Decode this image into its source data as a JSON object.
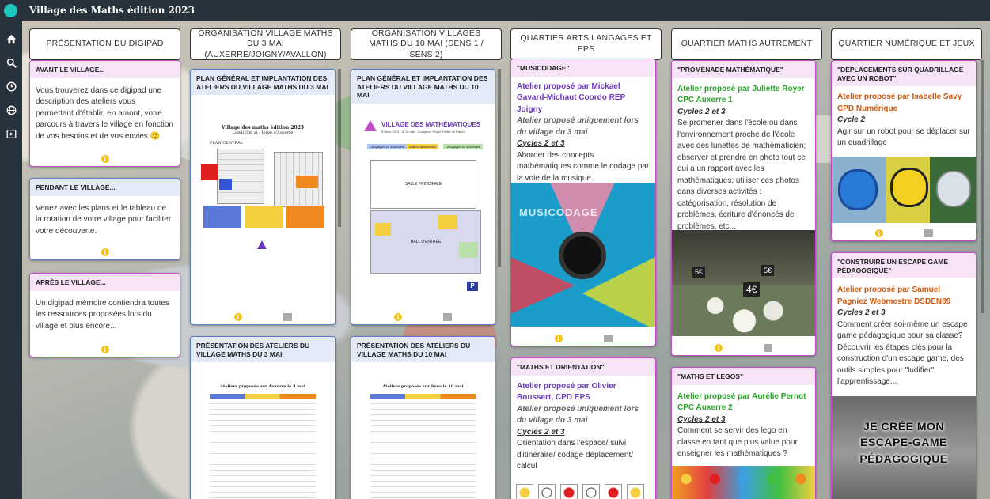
{
  "app": {
    "title": "Village des Maths édition 2023"
  },
  "sidebar": {
    "icons": [
      "home-icon",
      "search-icon",
      "history-icon",
      "globe-icon",
      "presentation-icon"
    ]
  },
  "columns": [
    {
      "title": "PRÉSENTATION DU DIGIPAD"
    },
    {
      "title": "ORGANISATION VILLAGE MATHS DU 3 MAI (AUXERRE/JOIGNY/AVALLON)"
    },
    {
      "title": "ORGANISATION VILLAGES MATHS DU 10 MAI (SENS 1 / SENS 2)"
    },
    {
      "title": "QUARTIER ARTS LANGAGES ET EPS"
    },
    {
      "title": "QUARTIER MATHS AUTREMENT"
    },
    {
      "title": "QUARTIER NUMÉRIQUE ET JEUX"
    }
  ],
  "cards": {
    "avant": {
      "title": "AVANT LE VILLAGE...",
      "text": "Vous trouverez dans ce digipad une description des ateliers vous permettant d'établir, en amont, votre parcours à travers le village en fonction de vos besoins et de vos envies",
      "emoji": "🙂"
    },
    "pendant": {
      "title": "PENDANT LE VILLAGE...",
      "text": "Venez avec les plans et le tableau de la rotation de votre village pour faciliter votre découverte."
    },
    "apres": {
      "title": "APRÈS LE VILLAGE...",
      "text": "Un digipad mémoire contiendra toutes les ressources proposées lors du village et plus encore..."
    },
    "plan3": {
      "title": "PLAN GÉNÉRAL ET IMPLANTATION DES ATELIERS DU VILLAGE MATHS DU 3 MAI",
      "doc_title": "Village des maths édition 2023",
      "doc_sub": "Lundi 3 m ai - Jorge d'Auxerre",
      "doc_label": "PLAN CENTRAL"
    },
    "plan10": {
      "title": "PLAN GÉNÉRAL ET IMPLANTATION DES ATELIERS DU VILLAGE MATHS DU 10 MAI",
      "doc_title": "VILLAGE DES MATHÉMATIQUES",
      "doc_sub": "Édition 2023 - le 10 mai - Complexe Roger Treillé de Paron",
      "legend": [
        "Langages et sciences",
        "Maths autrement",
        "Langages et sciences"
      ],
      "room": "SALLE PRINCIPALE",
      "hall": "HALL D'ENTRÉE"
    },
    "pres3": {
      "title": "PRÉSENTATION DES ATELIERS DU VILLAGE MATHS DU 3 MAI",
      "doc_head": "Ateliers proposés sur Auxerre le 3 mai"
    },
    "pres10": {
      "title": "PRÉSENTATION DES ATELIERS DU VILLAGE MATHS DU 10 MAI",
      "doc_head": "Ateliers proposés sur Sens le 10 mai"
    },
    "musicodage": {
      "title": "\"MUSICODAGE\"",
      "author": "Atelier proposé par Mickael Gavard-Michaut Coordo REP Joigny",
      "note": "Atelier proposé uniquement lors du village du 3 mai",
      "cycle": "Cycles 2 et 3",
      "text": "Aborder des concepts mathématiques comme le codage par la voie de la musique.",
      "image_text": "MUSICODAGE"
    },
    "orientation": {
      "title": "\"MATHS ET ORIENTATION\"",
      "author": "Atelier proposé par Olivier Boussert, CPD EPS",
      "note": "Atelier proposé uniquement lors du village du 3 mai",
      "cycle": "Cycles 2 et 3",
      "text": "Orientation dans l'espace/ suivi d'itinéraire/ codage déplacement/ calcul"
    },
    "promenade": {
      "title": "\"PROMENADE MATHÉMATIQUE\"",
      "author": "Atelier proposé par Juliette Royer CPC Auxerre 1",
      "cycle": "Cycles 2 et 3",
      "text": "Se promener dans l'école ou dans l'environnement proche de l'école avec des lunettes de mathématicien; observer et prendre en photo tout ce qui a un rapport avec les mathématiques; utiliser ces photos dans diverses activités : catégorisation, résolution de problèmes, écriture d'énoncés de problèmes, etc...",
      "price_tags": [
        "5€",
        "5€",
        "4€"
      ]
    },
    "legos": {
      "title": "\"MATHS ET LEGOS\"",
      "author": "Atelier proposé par Aurélie Pernot CPC Auxerre 2",
      "cycle": "Cycles 2 et 3",
      "text": "Comment se servir des lego en classe en tant que plus value pour enseigner les mathématiques ?"
    },
    "robot": {
      "title": "\"DÉPLACEMENTS SUR QUADRILLAGE AVEC UN ROBOT\"",
      "author": "Atelier proposé par Isabelle Savy CPD Numérique",
      "cycle": "Cycle 2",
      "text": "Agir sur un robot pour se déplacer sur un quadrillage"
    },
    "escape": {
      "title": "\"CONSTRUIRE UN ESCAPE GAME PÉDAGOGIQUE\"",
      "author": "Atelier proposé par Samuel Pagniez Webmestre DSDEN89",
      "cycle": "Cycles 2 et 3",
      "text": "Comment créer soi-même un escape game pédagogique pour sa classe? Découvrir les étapes clés pour la construction d'un escape game, des outils simples pour \"ludifier\" l'apprentissage...",
      "image_lines": [
        "JE CRÉE MON",
        "ESCAPE-GAME",
        "PÉDAGOGIQUE"
      ]
    }
  },
  "colors": {
    "topbar": "#28323c",
    "accent": "#1ec8c0",
    "pink": "#c04cc8",
    "blue": "#5c7cc8",
    "info": "#f4c20d"
  }
}
